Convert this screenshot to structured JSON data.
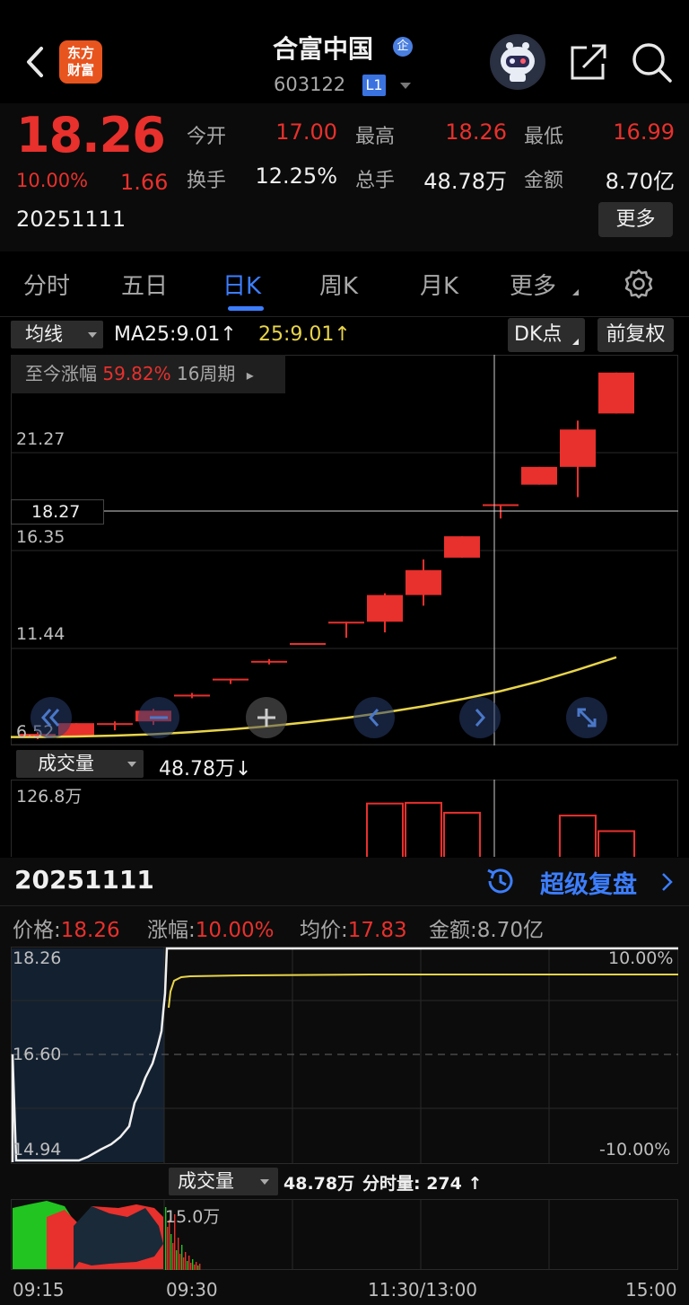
{
  "header": {
    "logo_line1": "东方",
    "logo_line2": "财富",
    "stock_name": "合富中国",
    "ent_badge": "企",
    "stock_code": "603122",
    "level_badge": "L1"
  },
  "quote": {
    "price": "18.26",
    "change_pct": "10.00%",
    "change": "1.66",
    "date": "20251111",
    "open_label": "今开",
    "open": "17.00",
    "high_label": "最高",
    "high": "18.26",
    "low_label": "最低",
    "low": "16.99",
    "turnover_label": "换手",
    "turnover": "12.25%",
    "volume_label": "总手",
    "volume": "48.78万",
    "amount_label": "金额",
    "amount": "8.70亿",
    "more_button": "更多"
  },
  "tabs": [
    {
      "label": "分时"
    },
    {
      "label": "五日"
    },
    {
      "label": "日K"
    },
    {
      "label": "周K"
    },
    {
      "label": "月K"
    },
    {
      "label": "更多"
    }
  ],
  "active_tab": "日K",
  "kline_toolbar": {
    "ma_dropdown": "均线",
    "ma_label": "MA25:9.01↑",
    "ma_value": "25:9.01↑",
    "dk_button": "DK点",
    "adjust_button": "前复权"
  },
  "kline": {
    "gain_label": "至今涨幅",
    "gain_value": "59.82%",
    "gain_period": "16周期",
    "gain_arrow": "▸",
    "y_labels": [
      "21.27",
      "16.35",
      "11.44",
      "6.52"
    ],
    "crosshair_price": "18.27",
    "colors": {
      "up": "#e8302c",
      "ma": "#e8d44a"
    }
  },
  "chart_data": {
    "type": "candlestick",
    "candles": [
      {
        "o": 6.5,
        "c": 6.7,
        "h": 6.8,
        "l": 6.4
      },
      {
        "o": 6.6,
        "c": 7.3,
        "h": 7.3,
        "l": 6.5
      },
      {
        "o": 7.3,
        "c": 7.3,
        "h": 7.4,
        "l": 6.9
      },
      {
        "o": 7.4,
        "c": 8.0,
        "h": 8.1,
        "l": 7.2
      },
      {
        "o": 8.8,
        "c": 8.9,
        "h": 9.0,
        "l": 8.7
      },
      {
        "o": 9.8,
        "c": 9.8,
        "h": 9.8,
        "l": 9.5
      },
      {
        "o": 10.8,
        "c": 10.8,
        "h": 10.9,
        "l": 10.6
      },
      {
        "o": 11.8,
        "c": 11.8,
        "h": 11.8,
        "l": 11.8
      },
      {
        "o": 13.0,
        "c": 13.0,
        "h": 13.0,
        "l": 12.1
      },
      {
        "o": 13.0,
        "c": 14.5,
        "h": 14.6,
        "l": 12.4
      },
      {
        "o": 14.5,
        "c": 15.9,
        "h": 16.5,
        "l": 13.9
      },
      {
        "o": 16.6,
        "c": 17.8,
        "h": 17.8,
        "l": 16.6
      },
      {
        "o": 19.6,
        "c": 19.6,
        "h": 19.6,
        "l": 18.8
      },
      {
        "o": 20.7,
        "c": 21.7,
        "h": 21.7,
        "l": 20.7
      },
      {
        "o": 21.7,
        "c": 23.8,
        "h": 24.3,
        "l": 20.0
      },
      {
        "o": 24.7,
        "c": 27.0,
        "h": 27.0,
        "l": 24.7
      }
    ],
    "ma25": [
      6.52,
      6.55,
      6.6,
      6.68,
      6.8,
      6.95,
      7.13,
      7.35,
      7.6,
      7.9,
      8.25,
      8.65,
      9.1,
      9.65,
      10.3,
      11.0
    ],
    "y_range": [
      6.4,
      28.0
    ],
    "volumes_wan": [
      0,
      0,
      0,
      0,
      0,
      0,
      0,
      0,
      0,
      93,
      94,
      80,
      0,
      13,
      76,
      54
    ],
    "vol_label": "126.8万",
    "crosshair_index": 12
  },
  "volume_toolbar": {
    "dropdown": "成交量",
    "value": "48.78万↓"
  },
  "lower": {
    "date": "20251111",
    "replay_label": "超级复盘",
    "price_label": "价格:",
    "price": "18.26",
    "zf_label": "涨幅:",
    "zf": "10.00%",
    "avg_label": "均价:",
    "avg": "17.83",
    "amt_label": "金额:",
    "amt": "8.70亿",
    "y_top": "18.26",
    "y_mid": "16.60",
    "y_bot": "14.94",
    "pct_top": "10.00%",
    "pct_bot": "-10.00%",
    "vol_dropdown": "成交量",
    "vol_value": "48.78万",
    "minute_vol": "分时量: 274 ↑",
    "vol_scale": "15.0万",
    "times": [
      "09:15",
      "09:30",
      "11:30/13:00",
      "15:00"
    ]
  }
}
